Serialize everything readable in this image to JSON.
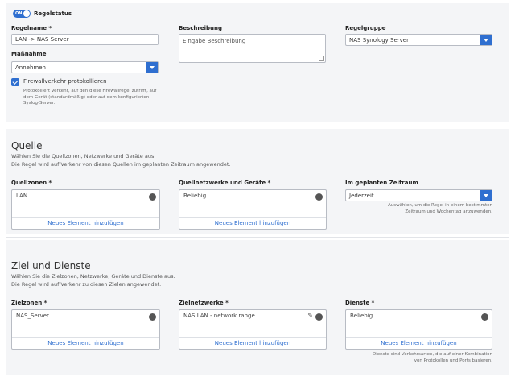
{
  "rule_status": {
    "toggle_text": "ON",
    "label": "Regelstatus"
  },
  "rule_name": {
    "label": "Regelname *",
    "value": "LAN -> NAS Server"
  },
  "description": {
    "label": "Beschreibung",
    "placeholder": "Eingabe Beschreibung"
  },
  "rule_group": {
    "label": "Regelgruppe",
    "value": "NAS Synology Server"
  },
  "action": {
    "label": "Maßnahme",
    "value": "Annehmen"
  },
  "log_traffic": {
    "label": "Firewallverkehr protokollieren",
    "checked": true,
    "note_line1": "Protokolliert Verkehr, auf den diese Firewallregel zutrifft, auf",
    "note_line2": "dem Gerät (standardmäßig) oder auf dem konfigurierten",
    "note_line3": "Syslog-Server."
  },
  "source": {
    "title": "Quelle",
    "desc_line1": "Wählen Sie die Quellzonen, Netzwerke und Geräte aus.",
    "desc_line2": "Die Regel wird auf Verkehr von diesen Quellen im geplanten Zeitraum angewendet.",
    "zones": {
      "label": "Quellzonen *",
      "item": "LAN",
      "add": "Neues Element hinzufügen"
    },
    "networks": {
      "label": "Quellnetzwerke und Geräte *",
      "item": "Beliebig",
      "add": "Neues Element hinzufügen"
    },
    "schedule": {
      "label": "Im geplanten Zeitraum",
      "value": "Jederzeit",
      "note_line1": "Auswählen, um die Regel in einem bestimmten",
      "note_line2": "Zeitraum und Wochentag anzuwenden."
    }
  },
  "destination": {
    "title": "Ziel und Dienste",
    "desc_line1": "Wählen Sie die Zielzonen, Netzwerke, Geräte und Dienste aus.",
    "desc_line2": "Die Regel wird auf Verkehr zu diesen Zielen angewendet.",
    "zones": {
      "label": "Zielzonen *",
      "item": "NAS_Server",
      "add": "Neues Element hinzufügen"
    },
    "networks": {
      "label": "Zielnetzwerke *",
      "item": "NAS LAN - network range",
      "add": "Neues Element hinzufügen"
    },
    "services": {
      "label": "Dienste *",
      "item": "Beliebig",
      "add": "Neues Element hinzufügen",
      "note_line1": "Dienste sind Verkehrsarten, die auf einer Kombination",
      "note_line2": "von Protokollen und Ports basieren."
    }
  },
  "colors": {
    "accent": "#2f6fd0",
    "panel": "#f4f5f7",
    "border": "#b8bcc4"
  }
}
